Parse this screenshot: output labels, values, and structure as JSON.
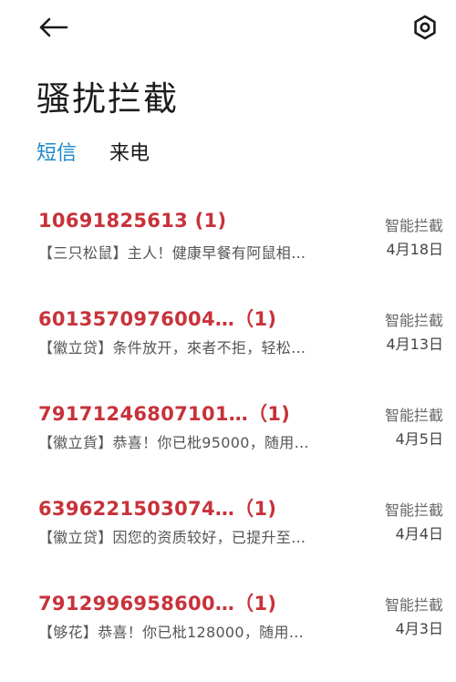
{
  "header": {
    "back_icon": "back-arrow-icon",
    "settings_icon": "settings-gear-icon",
    "title": "骚扰拦截"
  },
  "tabs": [
    {
      "label": "短信",
      "active": true
    },
    {
      "label": "来电",
      "active": false
    }
  ],
  "colors": {
    "accent": "#1e88c8",
    "sender": "#c8323a"
  },
  "messages": [
    {
      "sender": "10691825613 (1)",
      "preview": "【三只松鼠】主人！健康早餐有阿鼠相…",
      "tag": "智能拦截",
      "date": "4月18日"
    },
    {
      "sender": "6013570976004…（1)",
      "preview": "【徽立贷】条件放开，來者不拒，轻松…",
      "tag": "智能拦截",
      "date": "4月13日"
    },
    {
      "sender": "79171246807101…（1)",
      "preview": "【徽立貨】恭喜！你已枇95000，随用…",
      "tag": "智能拦截",
      "date": "4月5日"
    },
    {
      "sender": "6396221503074…（1)",
      "preview": "【徽立贷】因您的资质较好，已提升至…",
      "tag": "智能拦截",
      "date": "4月4日"
    },
    {
      "sender": "7912996958600…（1)",
      "preview": "【够花】恭喜！你已枇128000，随用…",
      "tag": "智能拦截",
      "date": "4月3日"
    }
  ]
}
